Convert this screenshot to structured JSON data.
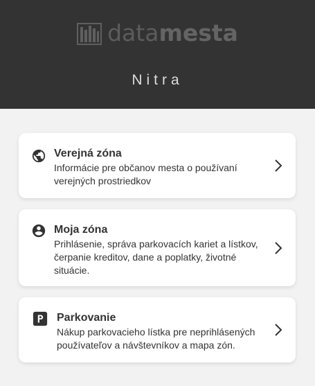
{
  "header": {
    "logo_light": "data",
    "logo_bold": "mesta",
    "city": "Nitra",
    "logo_icon": "datamesta-logo-icon"
  },
  "cards": [
    {
      "title": "Verejná zóna",
      "description": "Informácie pre občanov mesta o používaní verejných prostriedkov",
      "icon": "globe-icon"
    },
    {
      "title": "Moja zóna",
      "description": "Prihlásenie, správa parkovacích kariet a lístkov, čerpanie kreditov, dane a poplatky, životné situácie.",
      "icon": "account-circle-icon"
    },
    {
      "title": "Parkovanie",
      "description": "Nákup parkovacieho lístka pre neprihlásených používateľov a návštevníkov a mapa zón.",
      "icon": "parking-icon"
    }
  ],
  "colors": {
    "header_bg": "#333333",
    "page_bg": "#f2f2f2",
    "card_bg": "#ffffff",
    "text": "#333333"
  }
}
